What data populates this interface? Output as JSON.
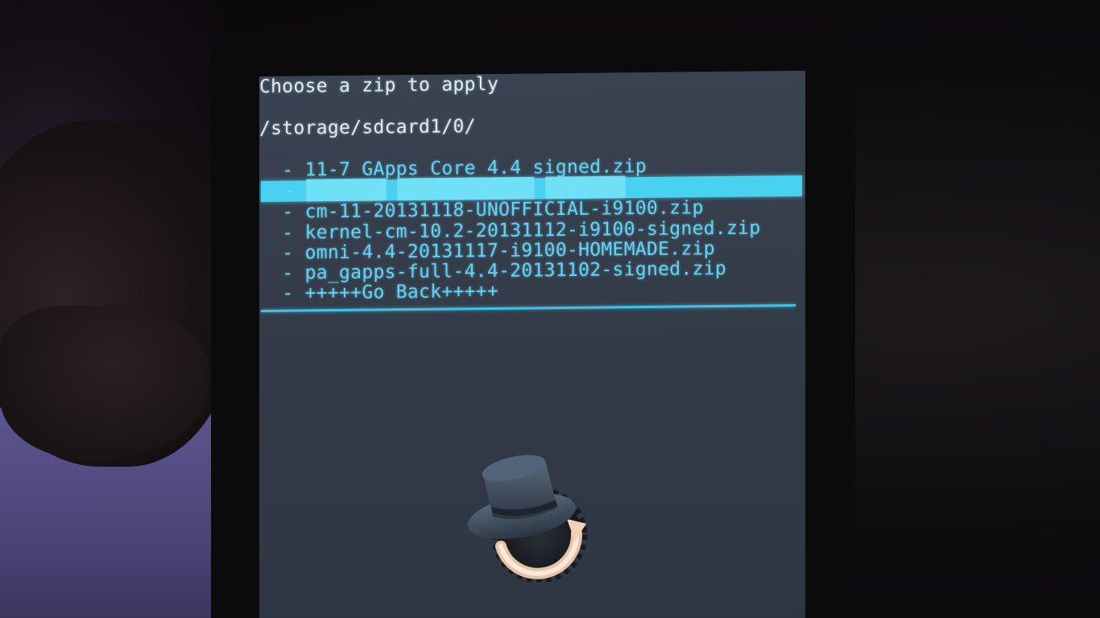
{
  "recovery": {
    "title": "Choose a zip to apply",
    "path": "/storage/sdcard1/0/",
    "items": [
      "  - 11-7 GApps Core 4.4 signed.zip",
      "  - cm-11-20131118-UNOFFICIAL-i9100.zip",
      "  - kernel-cm-10.2-20131112-i9100-signed.zip",
      "  - omni-4.4-20131117-i9100-HOMEMADE.zip",
      "  - pa_gapps-full-4.4-20131102-signed.zip",
      "  - +++++Go Back+++++"
    ],
    "selected_index": 1
  },
  "colors": {
    "menu_text": "#5fd4f4",
    "header_text": "#d9eef7",
    "highlight": "#49d1f0",
    "screen_bg": "#343c49"
  },
  "icons": {
    "logo": "clockworkmod-hat-icon"
  }
}
